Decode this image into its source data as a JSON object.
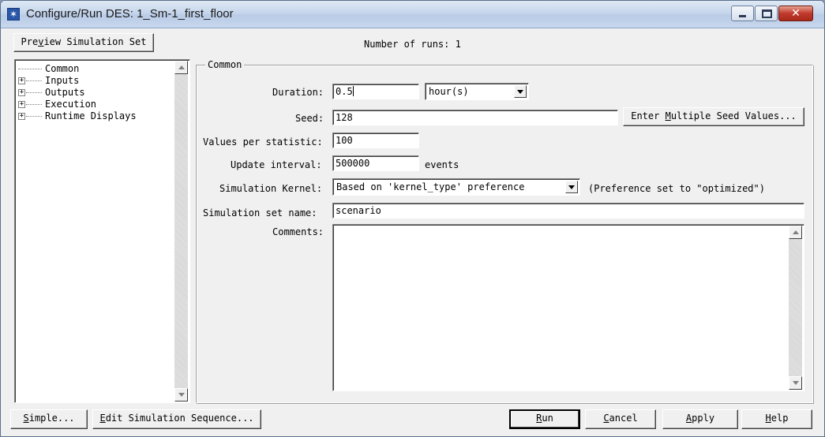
{
  "window": {
    "title": "Configure/Run DES: 1_Sm-1_first_floor",
    "icon": "star-app-icon"
  },
  "top": {
    "preview_button": {
      "pre": "Pre",
      "accel": "v",
      "post": "iew Simulation Set"
    },
    "runs_label": "Number of runs: 1"
  },
  "tree": {
    "items": [
      {
        "label": "Common",
        "expandable": false
      },
      {
        "label": "Inputs",
        "expandable": true
      },
      {
        "label": "Outputs",
        "expandable": true
      },
      {
        "label": "Execution",
        "expandable": true
      },
      {
        "label": "Runtime Displays",
        "expandable": true
      }
    ]
  },
  "group": {
    "title": "Common"
  },
  "form": {
    "duration_label": "Duration:",
    "duration_value": "0.5",
    "duration_unit": "hour(s)",
    "seed_label": "Seed:",
    "seed_value": "128",
    "multi_seed_button": {
      "pre": "Enter ",
      "accel": "M",
      "post": "ultiple Seed Values..."
    },
    "values_label": "Values per statistic:",
    "values_value": "100",
    "update_label": "Update interval:",
    "update_value": "500000",
    "update_unit": "events",
    "kernel_label": "Simulation Kernel:",
    "kernel_value": "Based on 'kernel_type' preference",
    "kernel_note": "(Preference set to \"optimized\")",
    "setname_label": "Simulation set name:",
    "setname_value": "scenario",
    "comments_label": "Comments:",
    "comments_value": ""
  },
  "bottom": {
    "simple": {
      "accel": "S",
      "post": "imple..."
    },
    "edit_seq": {
      "accel": "E",
      "post": "dit Simulation Sequence..."
    },
    "run": {
      "accel": "R",
      "post": "un"
    },
    "cancel": {
      "accel": "C",
      "post": "ancel"
    },
    "apply": {
      "accel": "A",
      "post": "pply"
    },
    "help": {
      "accel": "H",
      "post": "elp"
    }
  }
}
